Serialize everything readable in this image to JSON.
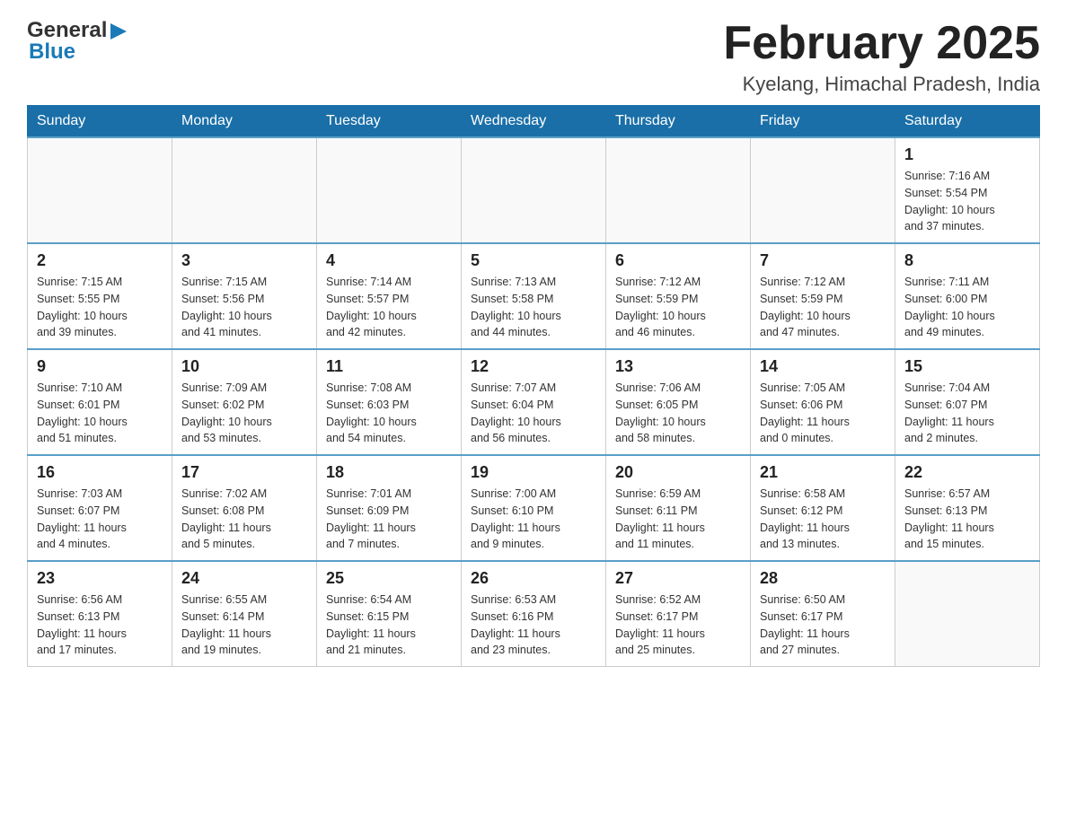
{
  "header": {
    "logo_general": "General",
    "logo_blue": "Blue",
    "title": "February 2025",
    "subtitle": "Kyelang, Himachal Pradesh, India"
  },
  "days_of_week": [
    "Sunday",
    "Monday",
    "Tuesday",
    "Wednesday",
    "Thursday",
    "Friday",
    "Saturday"
  ],
  "weeks": [
    [
      {
        "day": "",
        "info": ""
      },
      {
        "day": "",
        "info": ""
      },
      {
        "day": "",
        "info": ""
      },
      {
        "day": "",
        "info": ""
      },
      {
        "day": "",
        "info": ""
      },
      {
        "day": "",
        "info": ""
      },
      {
        "day": "1",
        "info": "Sunrise: 7:16 AM\nSunset: 5:54 PM\nDaylight: 10 hours\nand 37 minutes."
      }
    ],
    [
      {
        "day": "2",
        "info": "Sunrise: 7:15 AM\nSunset: 5:55 PM\nDaylight: 10 hours\nand 39 minutes."
      },
      {
        "day": "3",
        "info": "Sunrise: 7:15 AM\nSunset: 5:56 PM\nDaylight: 10 hours\nand 41 minutes."
      },
      {
        "day": "4",
        "info": "Sunrise: 7:14 AM\nSunset: 5:57 PM\nDaylight: 10 hours\nand 42 minutes."
      },
      {
        "day": "5",
        "info": "Sunrise: 7:13 AM\nSunset: 5:58 PM\nDaylight: 10 hours\nand 44 minutes."
      },
      {
        "day": "6",
        "info": "Sunrise: 7:12 AM\nSunset: 5:59 PM\nDaylight: 10 hours\nand 46 minutes."
      },
      {
        "day": "7",
        "info": "Sunrise: 7:12 AM\nSunset: 5:59 PM\nDaylight: 10 hours\nand 47 minutes."
      },
      {
        "day": "8",
        "info": "Sunrise: 7:11 AM\nSunset: 6:00 PM\nDaylight: 10 hours\nand 49 minutes."
      }
    ],
    [
      {
        "day": "9",
        "info": "Sunrise: 7:10 AM\nSunset: 6:01 PM\nDaylight: 10 hours\nand 51 minutes."
      },
      {
        "day": "10",
        "info": "Sunrise: 7:09 AM\nSunset: 6:02 PM\nDaylight: 10 hours\nand 53 minutes."
      },
      {
        "day": "11",
        "info": "Sunrise: 7:08 AM\nSunset: 6:03 PM\nDaylight: 10 hours\nand 54 minutes."
      },
      {
        "day": "12",
        "info": "Sunrise: 7:07 AM\nSunset: 6:04 PM\nDaylight: 10 hours\nand 56 minutes."
      },
      {
        "day": "13",
        "info": "Sunrise: 7:06 AM\nSunset: 6:05 PM\nDaylight: 10 hours\nand 58 minutes."
      },
      {
        "day": "14",
        "info": "Sunrise: 7:05 AM\nSunset: 6:06 PM\nDaylight: 11 hours\nand 0 minutes."
      },
      {
        "day": "15",
        "info": "Sunrise: 7:04 AM\nSunset: 6:07 PM\nDaylight: 11 hours\nand 2 minutes."
      }
    ],
    [
      {
        "day": "16",
        "info": "Sunrise: 7:03 AM\nSunset: 6:07 PM\nDaylight: 11 hours\nand 4 minutes."
      },
      {
        "day": "17",
        "info": "Sunrise: 7:02 AM\nSunset: 6:08 PM\nDaylight: 11 hours\nand 5 minutes."
      },
      {
        "day": "18",
        "info": "Sunrise: 7:01 AM\nSunset: 6:09 PM\nDaylight: 11 hours\nand 7 minutes."
      },
      {
        "day": "19",
        "info": "Sunrise: 7:00 AM\nSunset: 6:10 PM\nDaylight: 11 hours\nand 9 minutes."
      },
      {
        "day": "20",
        "info": "Sunrise: 6:59 AM\nSunset: 6:11 PM\nDaylight: 11 hours\nand 11 minutes."
      },
      {
        "day": "21",
        "info": "Sunrise: 6:58 AM\nSunset: 6:12 PM\nDaylight: 11 hours\nand 13 minutes."
      },
      {
        "day": "22",
        "info": "Sunrise: 6:57 AM\nSunset: 6:13 PM\nDaylight: 11 hours\nand 15 minutes."
      }
    ],
    [
      {
        "day": "23",
        "info": "Sunrise: 6:56 AM\nSunset: 6:13 PM\nDaylight: 11 hours\nand 17 minutes."
      },
      {
        "day": "24",
        "info": "Sunrise: 6:55 AM\nSunset: 6:14 PM\nDaylight: 11 hours\nand 19 minutes."
      },
      {
        "day": "25",
        "info": "Sunrise: 6:54 AM\nSunset: 6:15 PM\nDaylight: 11 hours\nand 21 minutes."
      },
      {
        "day": "26",
        "info": "Sunrise: 6:53 AM\nSunset: 6:16 PM\nDaylight: 11 hours\nand 23 minutes."
      },
      {
        "day": "27",
        "info": "Sunrise: 6:52 AM\nSunset: 6:17 PM\nDaylight: 11 hours\nand 25 minutes."
      },
      {
        "day": "28",
        "info": "Sunrise: 6:50 AM\nSunset: 6:17 PM\nDaylight: 11 hours\nand 27 minutes."
      },
      {
        "day": "",
        "info": ""
      }
    ]
  ]
}
